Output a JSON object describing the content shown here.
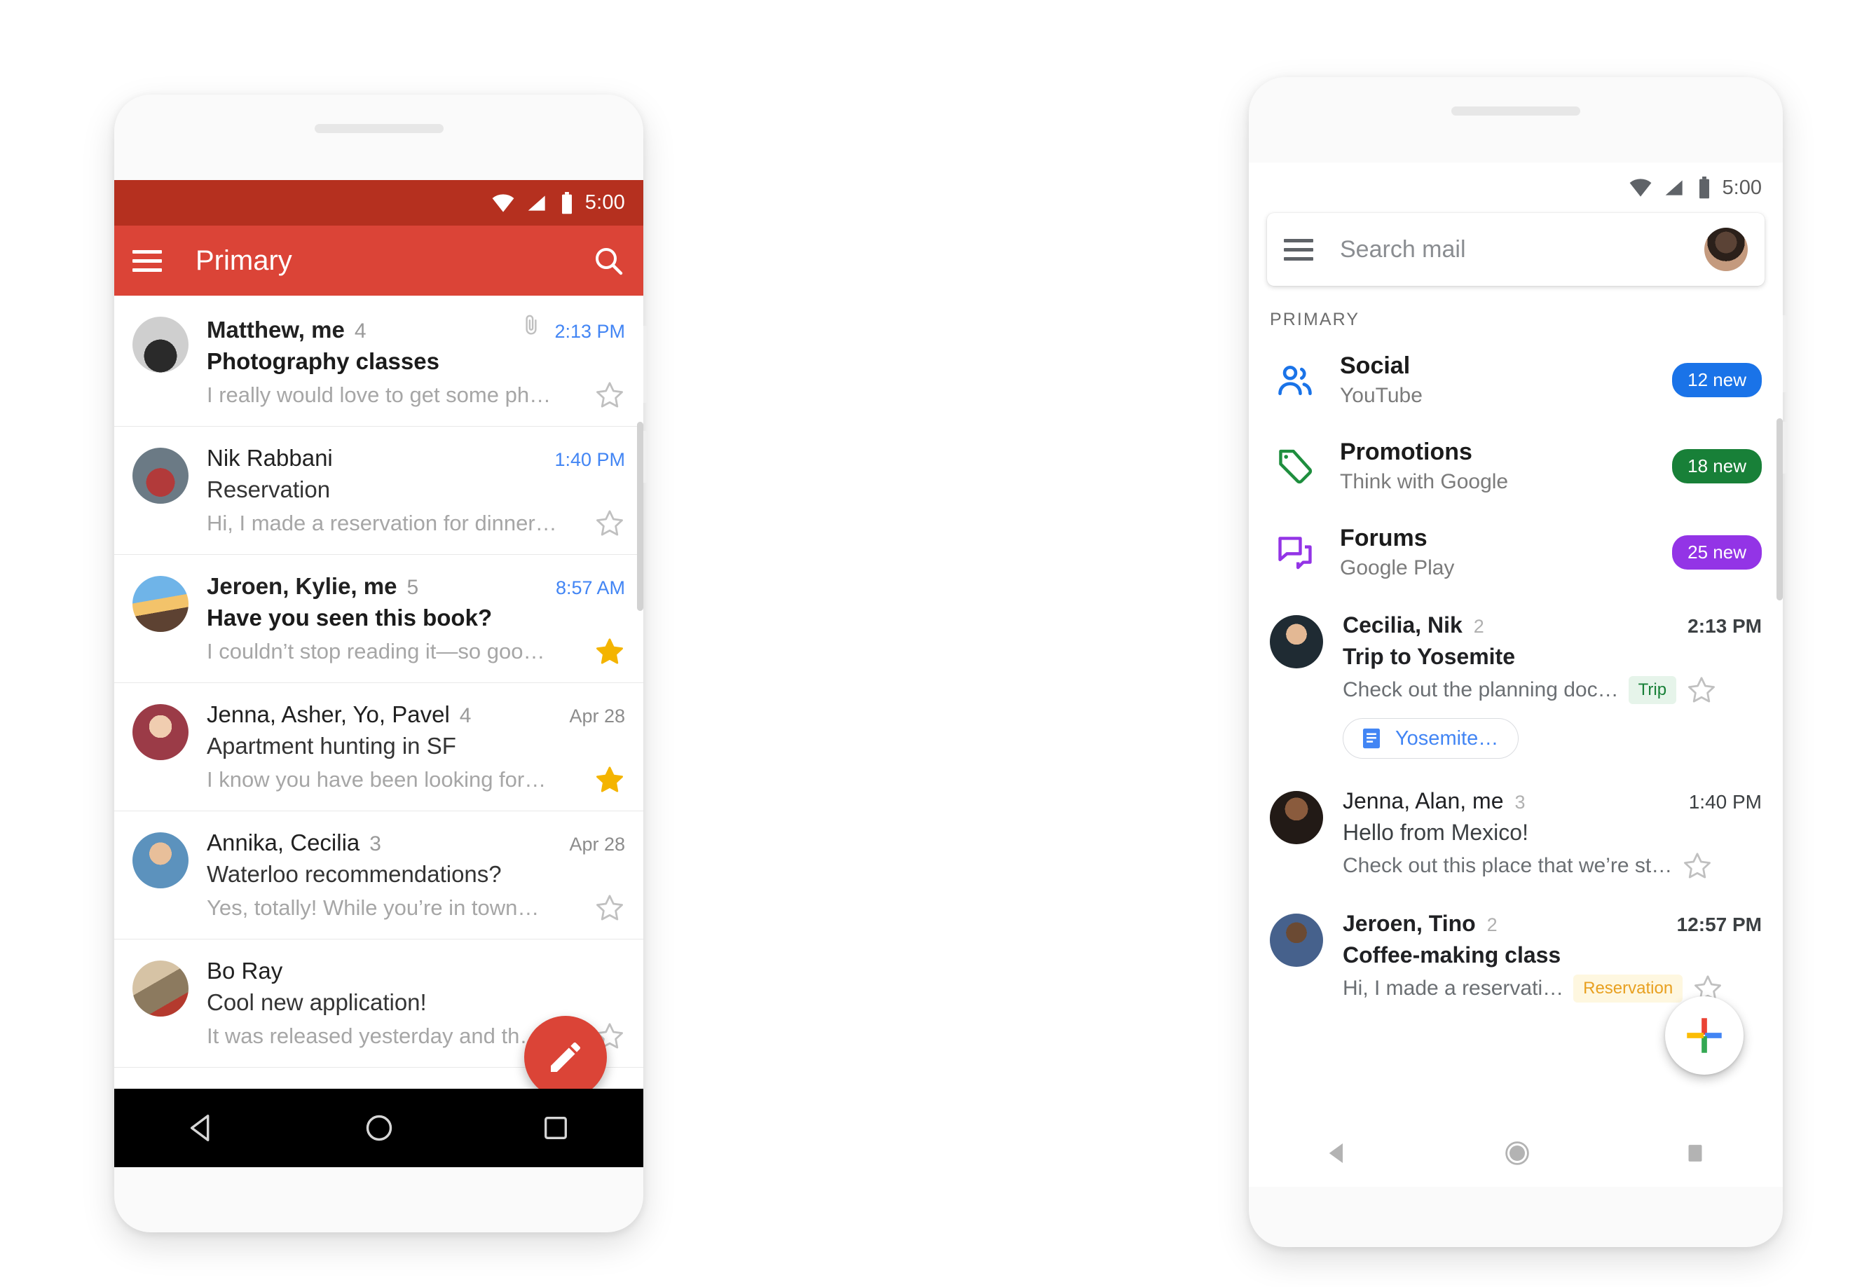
{
  "left_phone": {
    "status_bar": {
      "time": "5:00",
      "icons": [
        "wifi-icon",
        "signal-icon",
        "battery-icon"
      ]
    },
    "app_bar": {
      "title": "Primary",
      "menu_icon": "hamburger-menu-icon",
      "search_icon": "search-icon",
      "background": "#db4437"
    },
    "compose_fab": {
      "icon": "pencil-icon",
      "color": "#db4437"
    },
    "nav_bar": {
      "back": "back-triangle-icon",
      "home": "home-circle-icon",
      "recents": "recents-square-icon"
    },
    "messages": [
      {
        "sender": "Matthew, me",
        "count": "4",
        "subject": "Photography classes",
        "snippet": "I really would love to get some ph…",
        "time": "2:13 PM",
        "unread": true,
        "starred": false,
        "attachment": true
      },
      {
        "sender": "Nik Rabbani",
        "count": "",
        "subject": "Reservation",
        "snippet": "Hi, I made a reservation for dinner…",
        "time": "1:40 PM",
        "unread": false,
        "starred": false,
        "attachment": false
      },
      {
        "sender": "Jeroen, Kylie, me",
        "count": "5",
        "subject": "Have you seen this book?",
        "snippet": "I couldn’t stop reading it—so goo…",
        "time": "8:57 AM",
        "unread": true,
        "starred": true,
        "attachment": false
      },
      {
        "sender": "Jenna, Asher, Yo, Pavel",
        "count": "4",
        "subject": "Apartment hunting in SF",
        "snippet": "I know you have been looking for…",
        "time": "Apr 28",
        "unread": false,
        "starred": true,
        "attachment": false
      },
      {
        "sender": "Annika, Cecilia",
        "count": "3",
        "subject": "Waterloo recommendations?",
        "snippet": "Yes, totally! While you’re in town…",
        "time": "Apr 28",
        "unread": false,
        "starred": false,
        "attachment": false
      },
      {
        "sender": "Bo Ray",
        "count": "",
        "subject": "Cool new application!",
        "snippet": "It was released yesterday and th…",
        "time": "",
        "unread": false,
        "starred": false,
        "attachment": false
      }
    ]
  },
  "right_phone": {
    "status_bar": {
      "time": "5:00",
      "icons": [
        "wifi-icon",
        "signal-icon",
        "battery-icon"
      ]
    },
    "search": {
      "placeholder": "Search mail",
      "menu_icon": "hamburger-menu-icon",
      "avatar": "account-avatar"
    },
    "section_label": "PRIMARY",
    "categories": [
      {
        "title": "Social",
        "subtitle": "YouTube",
        "badge": "12 new",
        "badge_color": "#1a73e8",
        "icon": "people-icon",
        "icon_color": "#1a73e8"
      },
      {
        "title": "Promotions",
        "subtitle": "Think with Google",
        "badge": "18 new",
        "badge_color": "#188038",
        "icon": "tag-icon",
        "icon_color": "#1e8e3e"
      },
      {
        "title": "Forums",
        "subtitle": "Google Play",
        "badge": "25 new",
        "badge_color": "#9334e6",
        "icon": "forum-icon",
        "icon_color": "#9334e6"
      }
    ],
    "messages": [
      {
        "sender": "Cecilia, Nik",
        "count": "2",
        "subject": "Trip to Yosemite",
        "snippet": "Check out the planning doc…",
        "time": "2:13 PM",
        "unread": true,
        "starred": false,
        "chip": "Trip",
        "chip_bg": "#e6f4ea",
        "chip_fg": "#188038",
        "doc_chip": "Yosemite…",
        "doc_icon": "google-docs-icon"
      },
      {
        "sender": "Jenna, Alan, me",
        "count": "3",
        "subject": "Hello from Mexico!",
        "snippet": "Check out this place that we’re st…",
        "time": "1:40 PM",
        "unread": false,
        "starred": false,
        "chip": "",
        "chip_bg": "",
        "chip_fg": "",
        "doc_chip": "",
        "doc_icon": ""
      },
      {
        "sender": "Jeroen, Tino",
        "count": "2",
        "subject": "Coffee-making class",
        "snippet": "Hi, I made a reservati…",
        "time": "12:57 PM",
        "unread": true,
        "starred": false,
        "chip": "Reservation",
        "chip_bg": "#fef7e0",
        "chip_fg": "#e8a020",
        "doc_chip": "",
        "doc_icon": ""
      }
    ],
    "compose_fab": {
      "icon": "google-plus-icon",
      "colors": [
        "#ea4335",
        "#4285f4",
        "#34a853",
        "#fbbc05"
      ]
    },
    "nav_bar": {
      "back": "back-triangle-icon",
      "home": "home-circle-icon",
      "recents": "recents-square-icon"
    }
  }
}
